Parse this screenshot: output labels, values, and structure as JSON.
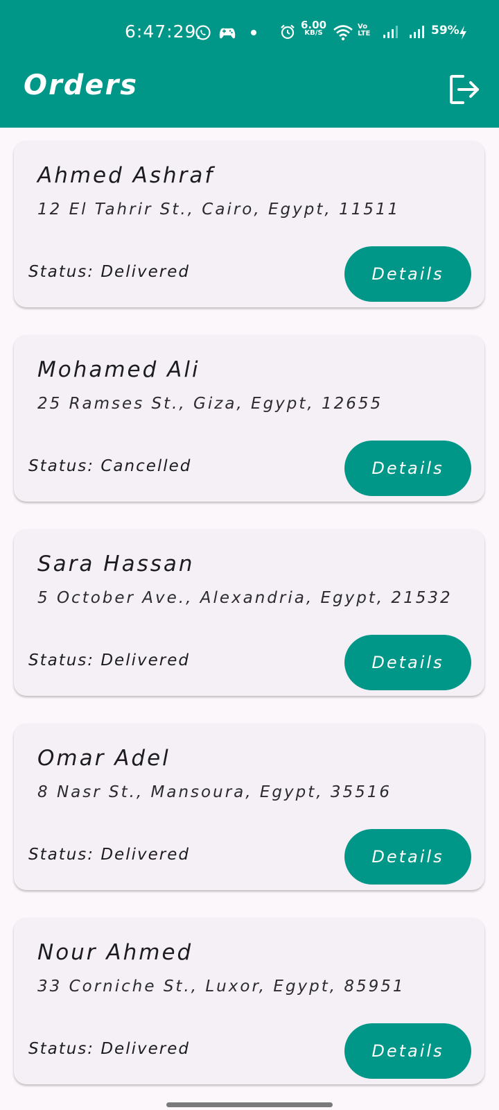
{
  "status_bar": {
    "time": "6:47:29",
    "net_speed_value": "6.00",
    "net_speed_unit": "KB/S",
    "volte_top": "Vo",
    "volte_bottom": "LTE",
    "battery": "59%"
  },
  "header": {
    "title": "Orders",
    "background_color": "#009688"
  },
  "orders": [
    {
      "name": "Ahmed Ashraf",
      "address": "12 El Tahrir St., Cairo, Egypt, 11511",
      "status": "Status: Delivered",
      "button_label": "Details"
    },
    {
      "name": "Mohamed Ali",
      "address": "25 Ramses St., Giza, Egypt, 12655",
      "status": "Status: Cancelled",
      "button_label": "Details"
    },
    {
      "name": "Sara Hassan",
      "address": "5 October Ave., Alexandria, Egypt, 21532",
      "status": "Status: Delivered",
      "button_label": "Details"
    },
    {
      "name": "Omar Adel",
      "address": "8 Nasr St., Mansoura, Egypt, 35516",
      "status": "Status: Delivered",
      "button_label": "Details"
    },
    {
      "name": "Nour Ahmed",
      "address": "33 Corniche St., Luxor, Egypt, 85951",
      "status": "Status: Delivered",
      "button_label": "Details"
    }
  ],
  "icons": {
    "logout": "logout-icon",
    "whatsapp": "whatsapp-icon",
    "game": "game-controller-icon",
    "alarm": "alarm-icon",
    "wifi": "wifi-icon",
    "signal": "signal-icon",
    "battery_charging": "charging-icon"
  },
  "colors": {
    "accent": "#009688",
    "card_background": "#f4f0f6",
    "page_background": "#fbf7fb"
  }
}
